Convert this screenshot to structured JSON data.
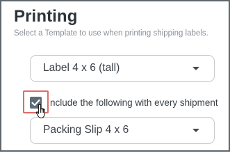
{
  "section": {
    "title": "Printing",
    "subtitle": "Select a Template to use when printing shipping labels."
  },
  "template_select": {
    "value": "Label 4 x 6 (tall)"
  },
  "include_option": {
    "label": "Include the following with every shipment",
    "label_visible": "nclude the following with every shipment",
    "checked": true
  },
  "packing_select": {
    "value": "Packing Slip 4 x 6"
  },
  "colors": {
    "checkbox_fill": "#5d6c78",
    "highlight": "#e06a6a",
    "title_text": "#2d3338",
    "subtitle_text": "#8a9097"
  },
  "icons": {
    "dropdown": "caret-down-icon",
    "checkbox": "checkmark-icon",
    "cursor": "hand-pointer-icon"
  }
}
